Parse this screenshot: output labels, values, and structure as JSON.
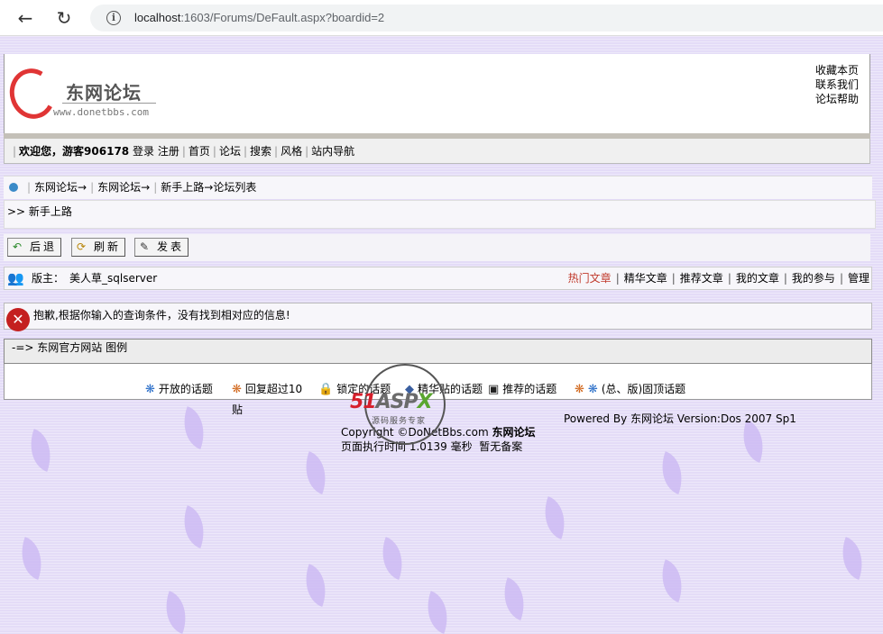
{
  "browser": {
    "url_host": "localhost",
    "url_rest": ":1603/Forums/DeFault.aspx?boardid=2"
  },
  "header": {
    "logo_title": "东网论坛",
    "logo_url": "www.donetbbs.com",
    "links": [
      "收藏本页",
      "联系我们",
      "论坛帮助"
    ]
  },
  "nav": {
    "welcome": "欢迎您，游客906178",
    "login": "登录",
    "register": "注册",
    "items": [
      "首页",
      "论坛",
      "搜索",
      "风格",
      "站内导航"
    ]
  },
  "breadcrumb": {
    "items": [
      "东网论坛→",
      "东网论坛→",
      "新手上路→论坛列表"
    ]
  },
  "forum_title": ">> 新手上路",
  "actions": {
    "back": "后退",
    "refresh": "刷新",
    "post": "发表"
  },
  "moderator": {
    "label": "版主：",
    "name": "美人草_sqlserver",
    "links": [
      "热门文章",
      "精华文章",
      "推荐文章",
      "我的文章",
      "我的参与",
      "管理"
    ]
  },
  "error_message": "抱歉,根据你输入的查询条件，没有找到相对应的信息!",
  "site_bar": "-=> 东网官方网站 图例",
  "legend": {
    "items": [
      "开放的话题",
      "回复超过10贴",
      "锁定的话题",
      "精华贴的话题",
      "推荐的话题",
      "(总、版)固顶话题"
    ]
  },
  "footer": {
    "powered": "Powered By 东网论坛 Version:Dos 2007 Sp1",
    "copyright_prefix": "Copyright ©DoNetBbs.com",
    "copyright_brand": "东网论坛",
    "exec_time": "页面执行时间 1.0139 毫秒",
    "icp": "暂无备案"
  },
  "watermark": {
    "brand_51": "51",
    "brand_asp": "ASP",
    "brand_x": "X",
    "sub": "源码服务专家"
  },
  "colors": {
    "background": "#e4dcf7",
    "hot_link": "#c0392b",
    "error_icon": "#c42020"
  }
}
